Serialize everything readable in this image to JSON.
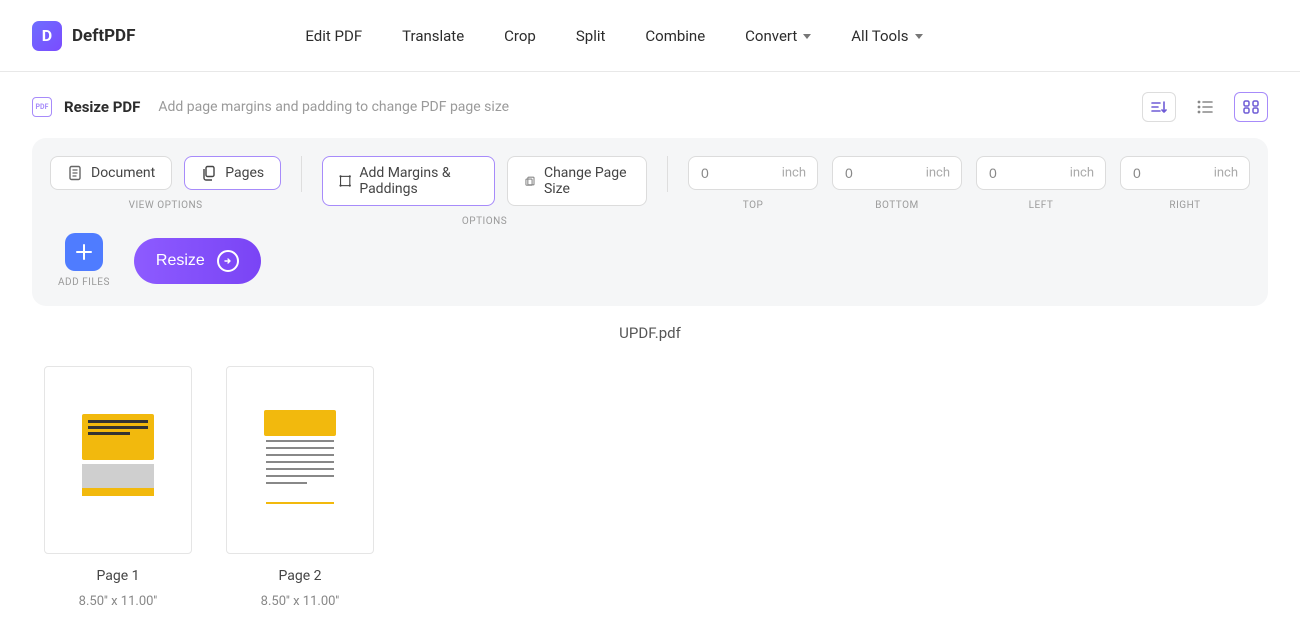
{
  "brand": {
    "name": "DeftPDF"
  },
  "nav": {
    "edit": "Edit PDF",
    "translate": "Translate",
    "crop": "Crop",
    "split": "Split",
    "combine": "Combine",
    "convert": "Convert",
    "all_tools": "All Tools"
  },
  "subheader": {
    "title": "Resize PDF",
    "desc": "Add page margins and padding to change PDF page size"
  },
  "toolbar": {
    "view_document": "Document",
    "view_pages": "Pages",
    "view_options_label": "VIEW OPTIONS",
    "add_margins": "Add Margins & Paddings",
    "change_page_size": "Change Page Size",
    "options_label": "OPTIONS",
    "unit": "inch",
    "labels": {
      "top": "TOP",
      "bottom": "BOTTOM",
      "left": "LEFT",
      "right": "RIGHT"
    },
    "values": {
      "top": "0",
      "bottom": "0",
      "left": "0",
      "right": "0"
    },
    "add_files_label": "ADD FILES",
    "resize_label": "Resize"
  },
  "file": {
    "name": "UPDF.pdf"
  },
  "pages": [
    {
      "label": "Page 1",
      "dimensions": "8.50'' x 11.00''"
    },
    {
      "label": "Page 2",
      "dimensions": "8.50'' x 11.00''"
    }
  ]
}
